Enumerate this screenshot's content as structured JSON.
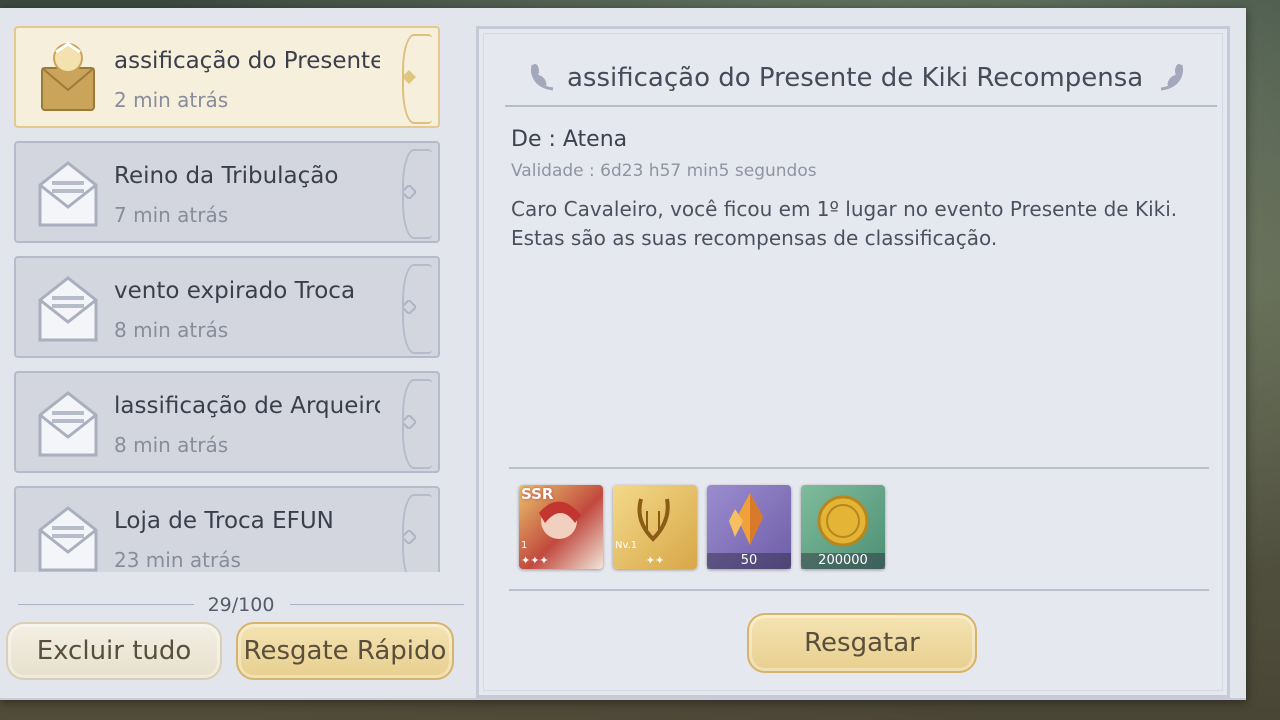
{
  "mail_list": {
    "items": [
      {
        "title": "assificação do Presente",
        "time": "2 min atrás",
        "active": true
      },
      {
        "title": "Reino da Tribulação",
        "time": "7 min atrás",
        "active": false
      },
      {
        "title": "vento expirado   Troca",
        "time": "8 min atrás",
        "active": false
      },
      {
        "title": "lassificação de Arqueiro",
        "time": "8 min atrás",
        "active": false
      },
      {
        "title": "Loja de Troca EFUN",
        "time": "23 min atrás",
        "active": false
      }
    ],
    "count": "29/100"
  },
  "buttons": {
    "delete_all": "Excluir tudo",
    "quick_claim": "Resgate Rápido",
    "claim": "Resgatar"
  },
  "detail": {
    "title": "assificação do Presente de Kiki   Recompensa",
    "from": "De : Atena",
    "validity": "Validade : 6d23 h57 min5 segundos",
    "body_line1": "Caro Cavaleiro, você ficou em 1º lugar no evento Presente de Kiki.",
    "body_line2": "Estas são as suas recompensas de classificação."
  },
  "rewards": [
    {
      "icon": "ssr-character-card-icon",
      "badge": "SSR",
      "level": "1",
      "stars": "✦✦✦"
    },
    {
      "icon": "golden-lyre-icon",
      "level": "Nv.1",
      "stars": "✦✦"
    },
    {
      "icon": "orange-crystal-icon",
      "quantity": "50"
    },
    {
      "icon": "gold-coin-icon",
      "quantity": "200000"
    }
  ],
  "colors": {
    "gold_accent": "#e3c98e",
    "panel_bg": "#e3e5ec"
  }
}
